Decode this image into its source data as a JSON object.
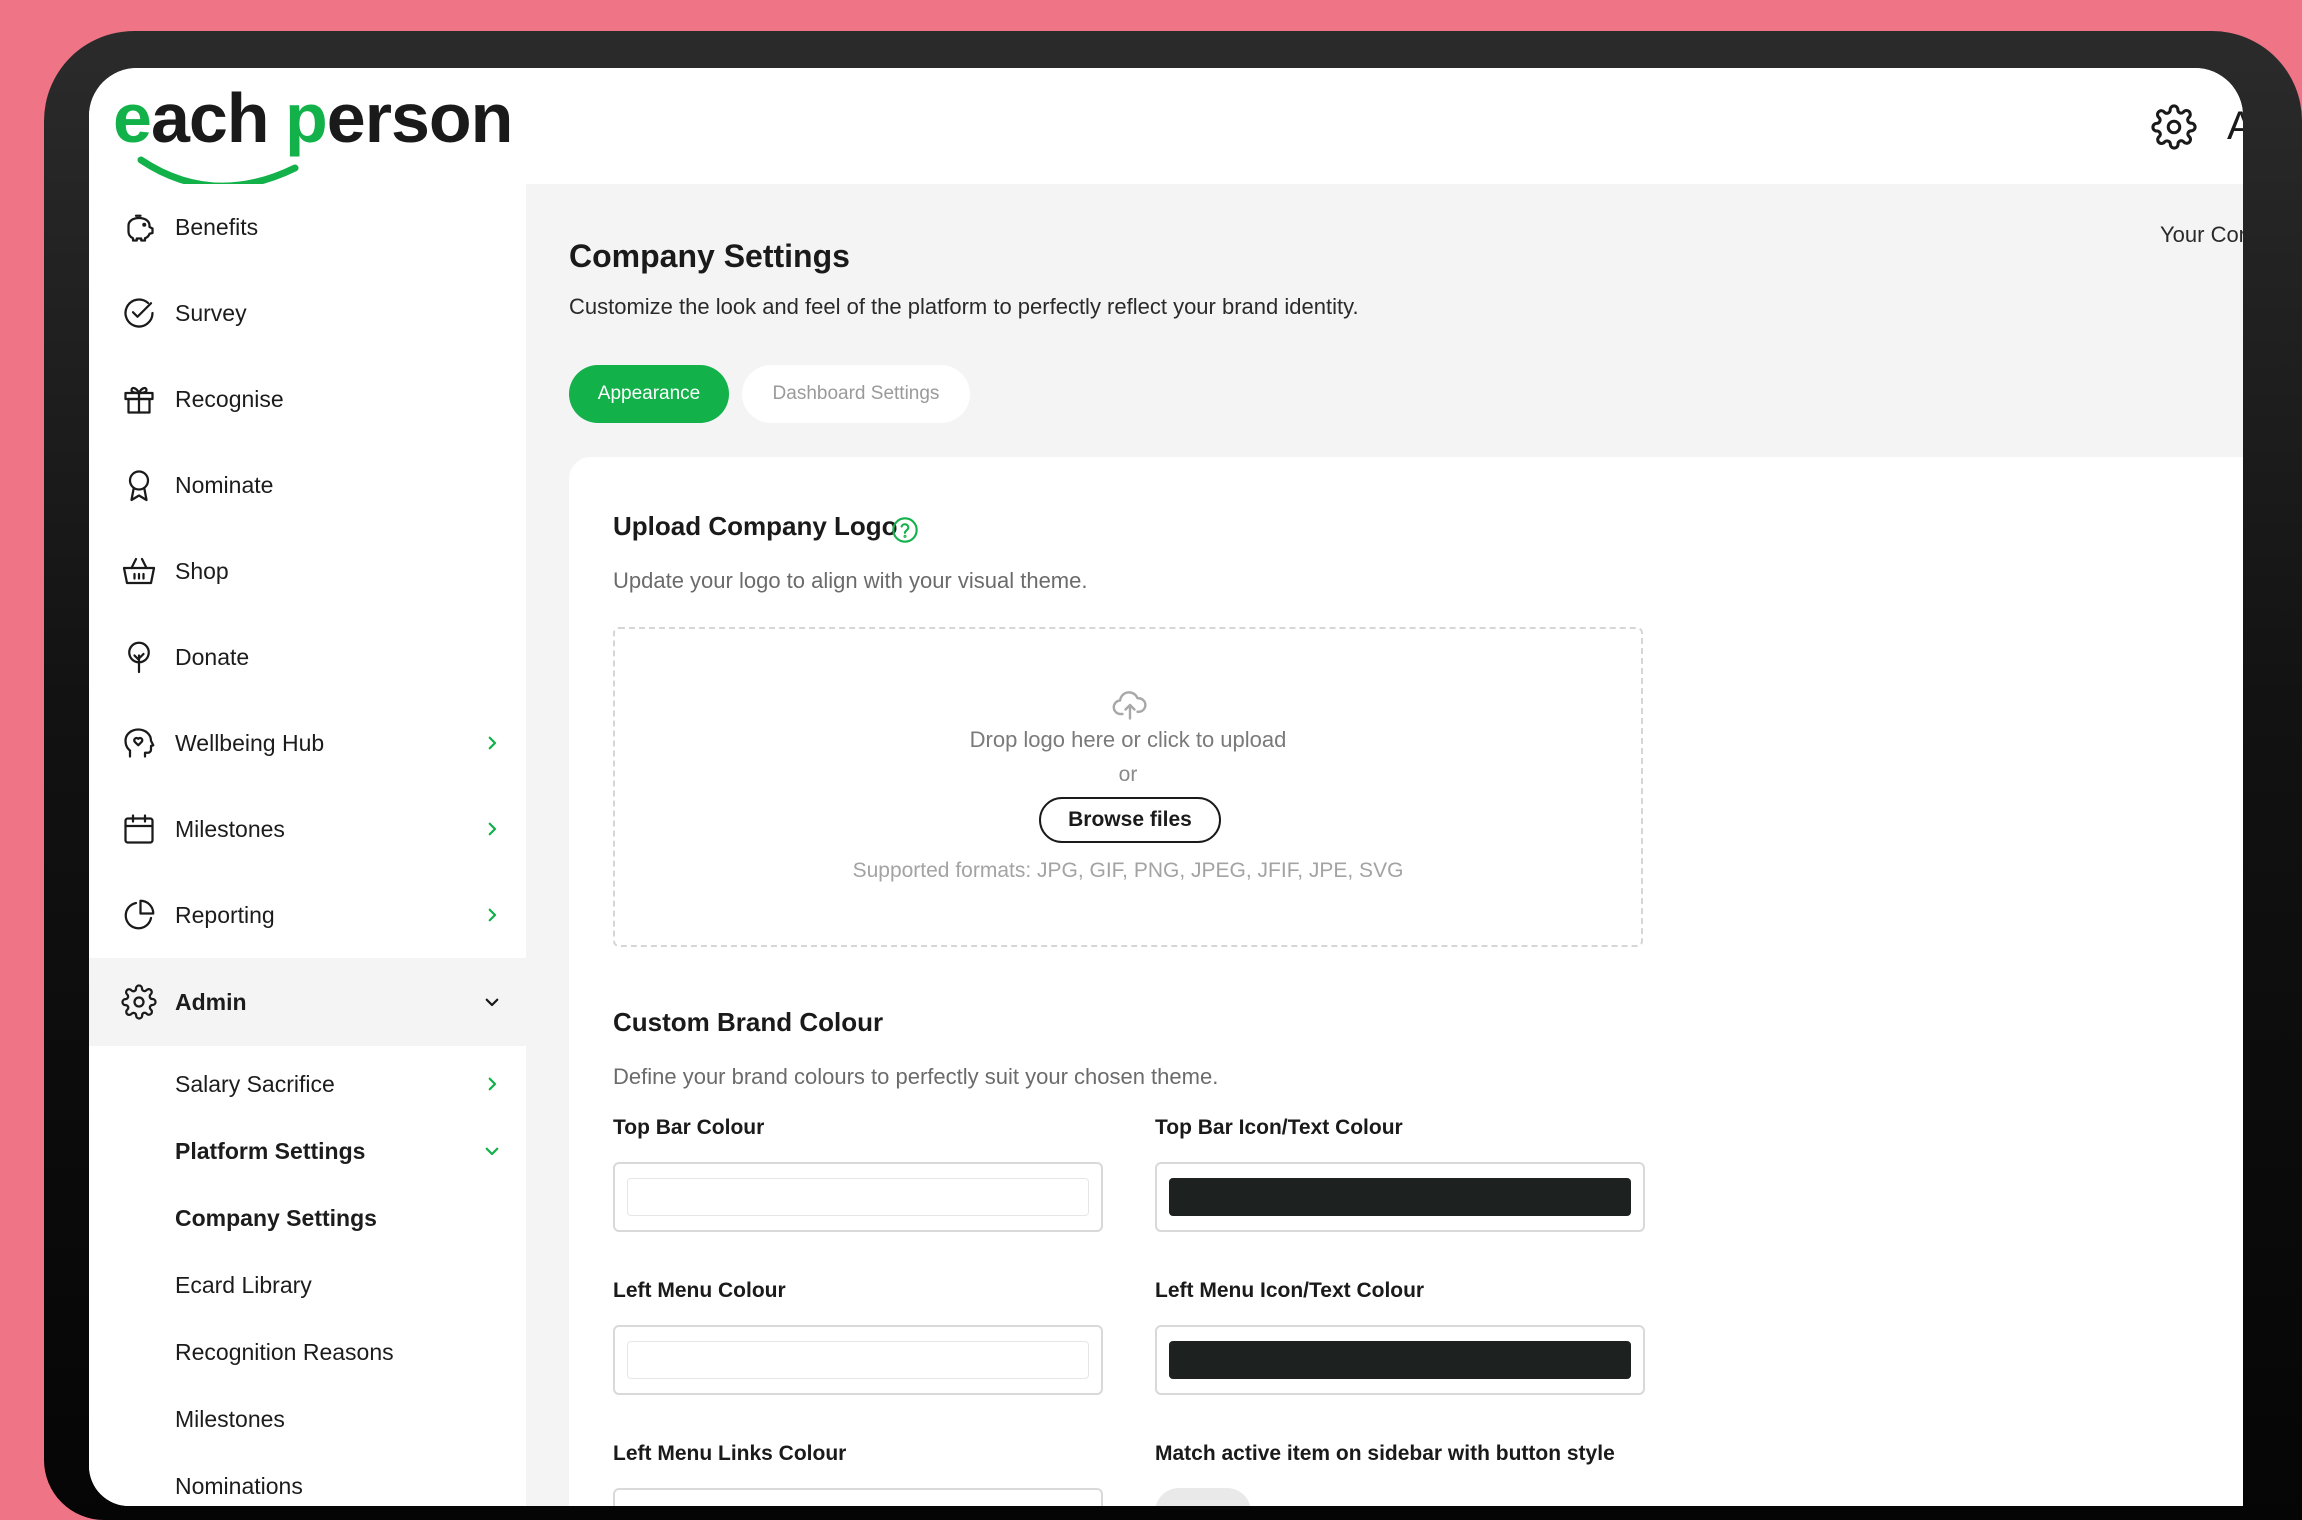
{
  "brand": {
    "logo_word_1": "each",
    "logo_word_2": "person",
    "green": "#12b14a"
  },
  "header": {
    "right_partial": "A"
  },
  "sidebar": {
    "items": [
      {
        "label": "Benefits",
        "icon": "piggy-bank-icon"
      },
      {
        "label": "Survey",
        "icon": "check-circle-icon"
      },
      {
        "label": "Recognise",
        "icon": "gift-icon"
      },
      {
        "label": "Nominate",
        "icon": "award-ribbon-icon"
      },
      {
        "label": "Shop",
        "icon": "basket-icon"
      },
      {
        "label": "Donate",
        "icon": "tree-icon"
      },
      {
        "label": "Wellbeing Hub",
        "icon": "head-heart-icon"
      },
      {
        "label": "Milestones",
        "icon": "calendar-icon"
      },
      {
        "label": "Reporting",
        "icon": "pie-chart-icon"
      },
      {
        "label": "Admin",
        "icon": "gear-icon"
      }
    ],
    "sub_items": [
      {
        "label": "Salary Sacrifice"
      },
      {
        "label": "Platform Settings"
      },
      {
        "label": "Company Settings"
      },
      {
        "label": "Ecard Library"
      },
      {
        "label": "Recognition Reasons"
      },
      {
        "label": "Milestones"
      },
      {
        "label": "Nominations"
      }
    ]
  },
  "main": {
    "title": "Company Settings",
    "subtitle": "Customize the look and feel of the platform to perfectly reflect your brand identity.",
    "breadcrumb_partial": "Your Comp",
    "tabs": [
      {
        "label": "Appearance",
        "active": true
      },
      {
        "label": "Dashboard Settings",
        "active": false
      }
    ],
    "logo_section": {
      "title": "Upload Company Logo",
      "description": "Update your logo to align with your visual theme.",
      "drop_text": "Drop logo here or click to upload",
      "or_text": "or",
      "browse_label": "Browse files",
      "formats": "Supported formats: JPG, GIF, PNG, JPEG, JFIF, JPE, SVG"
    },
    "brand_section": {
      "title": "Custom Brand Colour",
      "description": "Define your brand colours to perfectly suit your chosen theme.",
      "fields": [
        {
          "label": "Top Bar Colour",
          "color": "#ffffff"
        },
        {
          "label": "Top Bar Icon/Text Colour",
          "color": "#1d2221"
        },
        {
          "label": "Left Menu Colour",
          "color": "#ffffff"
        },
        {
          "label": "Left Menu Icon/Text Colour",
          "color": "#1d2221"
        },
        {
          "label": "Left Menu Links Colour"
        },
        {
          "label": "Match active item on sidebar with button style"
        }
      ]
    }
  }
}
